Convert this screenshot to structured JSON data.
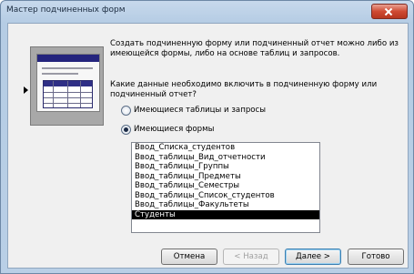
{
  "window": {
    "title": "Мастер подчиненных форм"
  },
  "intro": {
    "line1": "Создать подчиненную форму или подчиненный отчет можно либо из",
    "line2": "имеющейся формы, либо на основе таблиц и запросов."
  },
  "question": {
    "line1": "Какие данные необходимо включить в подчиненную форму или",
    "line2": "подчиненный отчет?"
  },
  "options": {
    "tables_label": "Имеющиеся таблицы и запросы",
    "forms_label": "Имеющиеся формы",
    "selected": "forms"
  },
  "forms_list": {
    "items": [
      "Ввод_Списка_студентов",
      "Ввод_таблицы_Вид_отчетности",
      "Ввод_таблицы_Группы",
      "Ввод_таблицы_Предметы",
      "Ввод_таблицы_Семестры",
      "Ввод_таблицы_Список_студентов",
      "Ввод_таблицы_Факультеты",
      "Студенты"
    ],
    "selected": "Студенты"
  },
  "buttons": {
    "cancel": "Отмена",
    "back": "< Назад",
    "next": "Далее >",
    "finish": "Готово"
  },
  "colors": {
    "selection": "#000000",
    "frame": "#b9cfe6",
    "close": "#cf4a33"
  }
}
